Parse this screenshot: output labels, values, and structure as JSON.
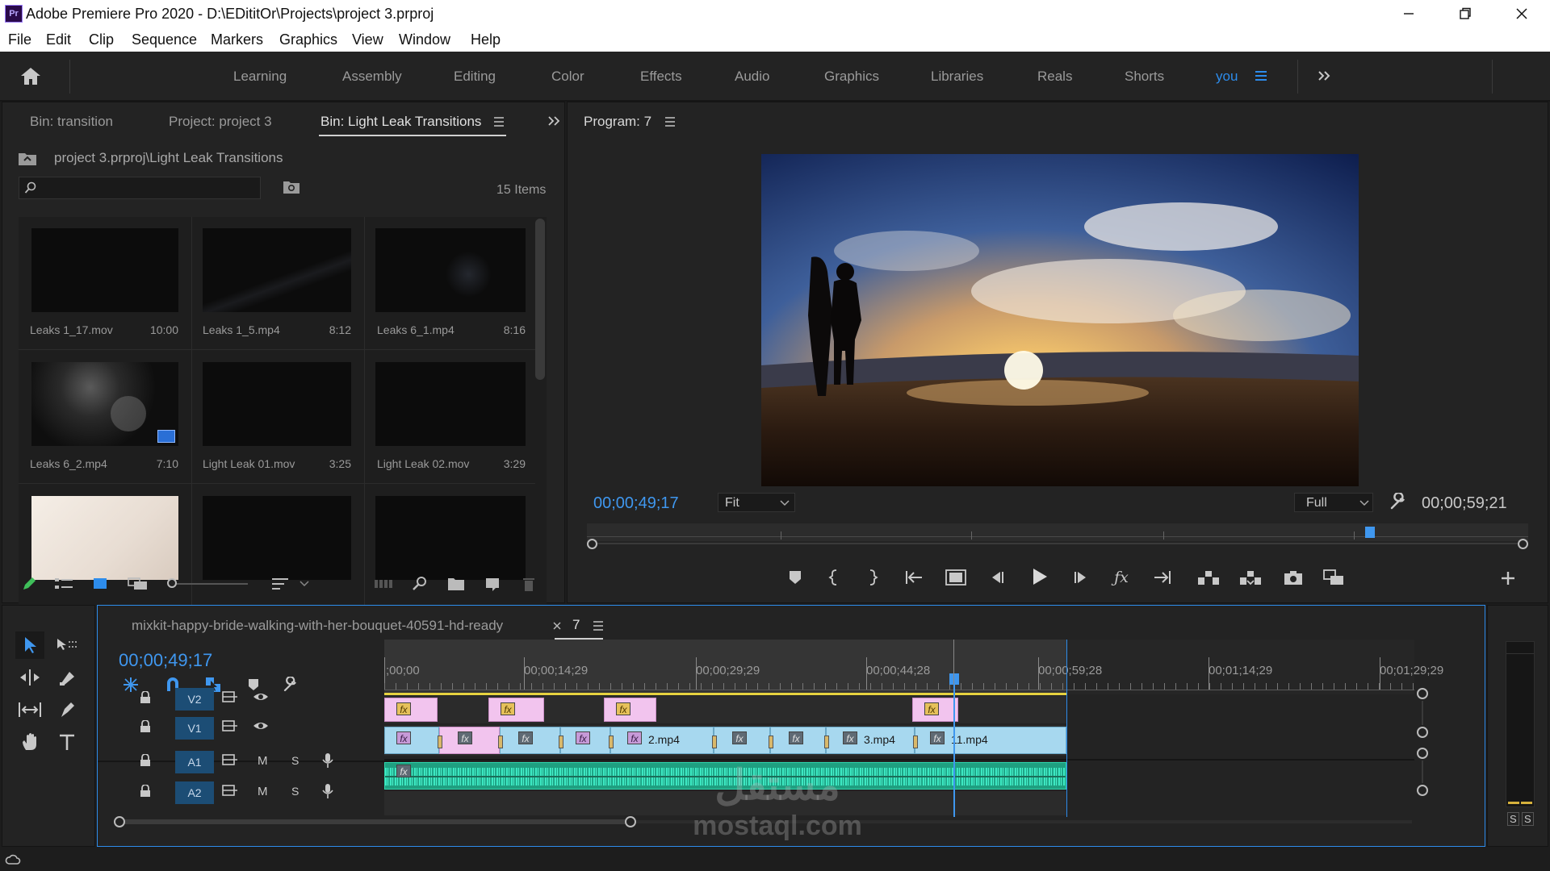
{
  "window": {
    "app_logo": "Pr",
    "title": "Adobe Premiere Pro 2020 - D:\\EDititOr\\Projects\\project 3.prproj"
  },
  "menu": [
    "File",
    "Edit",
    "Clip",
    "Sequence",
    "Markers",
    "Graphics",
    "View",
    "Window",
    "Help"
  ],
  "workspaces": {
    "tabs": [
      "Learning",
      "Assembly",
      "Editing",
      "Color",
      "Effects",
      "Audio",
      "Graphics",
      "Libraries",
      "Reals",
      "Shorts",
      "you"
    ],
    "active": "you",
    "accent": "#2d8ceb"
  },
  "project_panel": {
    "tabs": [
      "Bin: transition",
      "Project: project 3",
      "Bin: Light Leak Transitions"
    ],
    "active_tab": "Bin: Light Leak Transitions",
    "path": "project 3.prproj\\Light Leak Transitions",
    "search_placeholder": "",
    "item_count": "15 Items",
    "clips": [
      {
        "name": "Leaks 1_17.mov",
        "duration": "10:00"
      },
      {
        "name": "Leaks 1_5.mp4",
        "duration": "8:12"
      },
      {
        "name": "Leaks 6_1.mp4",
        "duration": "8:16"
      },
      {
        "name": "Leaks 6_2.mp4",
        "duration": "7:10"
      },
      {
        "name": "Light Leak 01.mov",
        "duration": "3:25"
      },
      {
        "name": "Light Leak 02.mov",
        "duration": "3:29"
      }
    ]
  },
  "program_monitor": {
    "title": "Program: 7",
    "current_timecode": "00;00;49;17",
    "duration_timecode": "00;00;59;21",
    "zoom": "Fit",
    "resolution": "Full"
  },
  "timeline": {
    "sequence_tabs": [
      "mixkit-happy-bride-walking-with-her-bouquet-40591-hd-ready",
      "7"
    ],
    "active_sequence": "7",
    "timecode": "00;00;49;17",
    "ruler_labels": [
      ";00;00",
      "00;00;14;29",
      "00;00;29;29",
      "00;00;44;28",
      "00;00;59;28",
      "00;01;14;29",
      "00;01;29;29"
    ],
    "tracks": {
      "video": [
        "V2",
        "V1"
      ],
      "audio": [
        "A1",
        "A2"
      ],
      "mute_label": "M",
      "solo_label": "S"
    },
    "clip_labels": [
      "2.mp4",
      "3.mp4",
      "11.mp4"
    ],
    "fx_label": "fx",
    "meter_labels": [
      "S",
      "S"
    ]
  },
  "watermark": {
    "brand": "مستقل",
    "url": "mostaql.com"
  }
}
